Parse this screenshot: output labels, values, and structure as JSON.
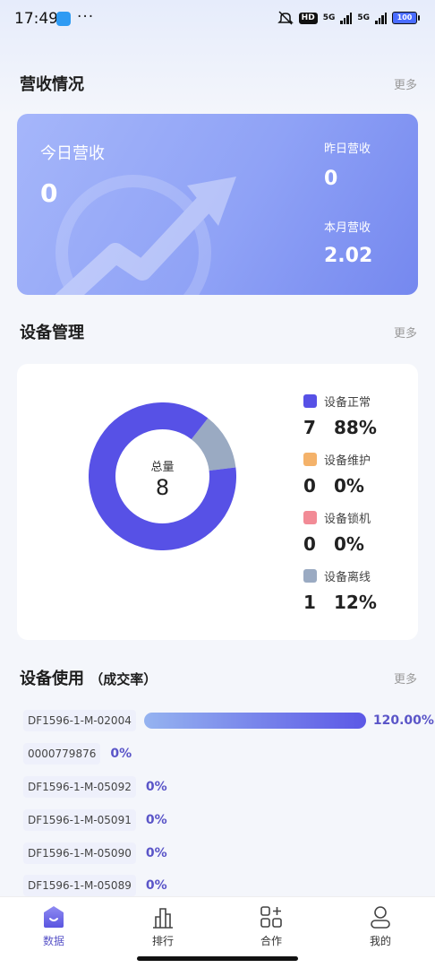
{
  "status_bar": {
    "time": "17:49",
    "dots": "···",
    "hd": "HD",
    "net1": "5G",
    "net2": "5G",
    "battery": "100"
  },
  "revenue": {
    "title": "营收情况",
    "more": "更多",
    "today_label": "今日营收",
    "today_value": "0",
    "yesterday_label": "昨日营收",
    "yesterday_value": "0",
    "month_label": "本月营收",
    "month_value": "2.02"
  },
  "devices": {
    "title": "设备管理",
    "more": "更多",
    "total_label": "总量",
    "total_value": "8",
    "legend": [
      {
        "label": "设备正常",
        "count": "7",
        "percent": "88%",
        "color": "#5751e6",
        "fraction": 0.875
      },
      {
        "label": "设备维护",
        "count": "0",
        "percent": "0%",
        "color": "#f4b26a",
        "fraction": 0
      },
      {
        "label": "设备锁机",
        "count": "0",
        "percent": "0%",
        "color": "#f28b96",
        "fraction": 0
      },
      {
        "label": "设备离线",
        "count": "1",
        "percent": "12%",
        "color": "#9aaac2",
        "fraction": 0.125
      }
    ]
  },
  "usage": {
    "title": "设备使用",
    "subtitle": "（成交率）",
    "more": "更多",
    "rows": [
      {
        "id": "DF1596-1-M-02004",
        "rate": "120.00%",
        "fill": 1.0
      },
      {
        "id": "0000779876",
        "rate": "0%",
        "fill": 0
      },
      {
        "id": "DF1596-1-M-05092",
        "rate": "0%",
        "fill": 0
      },
      {
        "id": "DF1596-1-M-05091",
        "rate": "0%",
        "fill": 0
      },
      {
        "id": "DF1596-1-M-05090",
        "rate": "0%",
        "fill": 0
      },
      {
        "id": "DF1596-1-M-05089",
        "rate": "0%",
        "fill": 0
      }
    ]
  },
  "tabbar": {
    "tabs": [
      {
        "label": "数据",
        "icon": "data-icon",
        "active": true
      },
      {
        "label": "排行",
        "icon": "ranking-icon",
        "active": false
      },
      {
        "label": "合作",
        "icon": "cooperation-icon",
        "active": false
      },
      {
        "label": "我的",
        "icon": "profile-icon",
        "active": false
      }
    ]
  }
}
